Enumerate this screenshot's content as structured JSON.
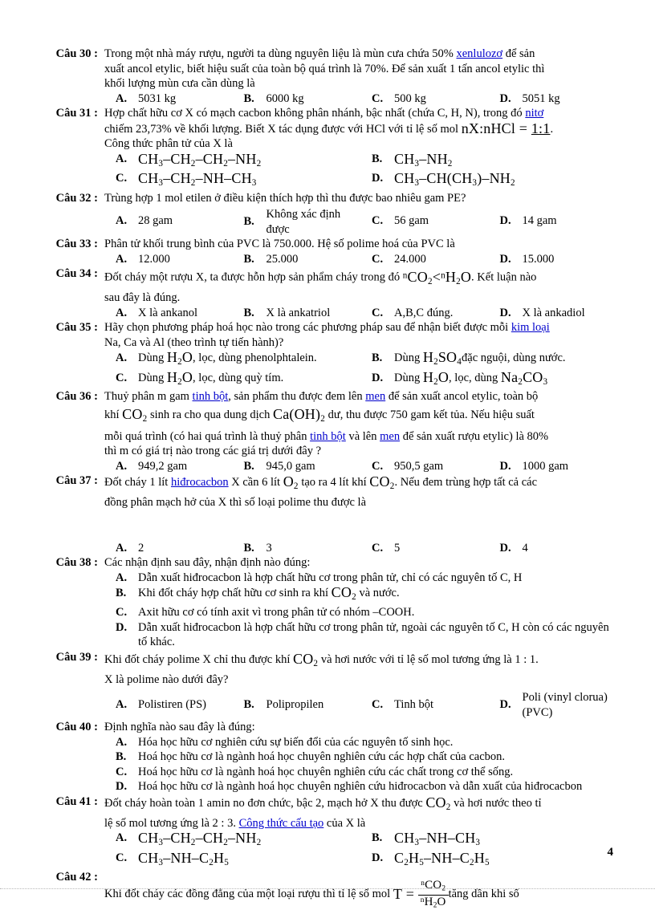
{
  "document": {
    "page_number": "4",
    "language": "vi"
  },
  "questions": [
    {
      "label": "Câu 30 :",
      "stem_lines": [
        "Trong một nhà máy rượu, người ta dùng nguyên liệu là mùn cưa chứa 50% xenlulozơ để sản",
        "xuất ancol etylic, biết hiệu suất của toàn bộ quá trình là 70%. Để sản xuất 1 tấn ancol etylic thì",
        "khối lượng mùn cưa cần dùng là"
      ],
      "link_terms": [
        "xenlulozơ"
      ],
      "answers": [
        {
          "key": "A.",
          "text": "5031 kg"
        },
        {
          "key": "B.",
          "text": "6000 kg"
        },
        {
          "key": "C.",
          "text": "500 kg"
        },
        {
          "key": "D.",
          "text": "5051 kg"
        }
      ]
    },
    {
      "label": "Câu 31 :",
      "stem_lines": [
        "Hợp chất hữu cơ X có mạch cacbon không phân nhánh, bậc nhất (chứa C, H, N), trong đó nitơ",
        "chiếm 23,73% về khối lượng. Biết X tác dụng được với HCl với tỉ lệ số mol nX:nHCl = 1:1.",
        "Công thức phân tử của X là"
      ],
      "link_terms": [
        "nitơ"
      ],
      "formula_inline": "nX:nHCl = 1:1",
      "answers": [
        {
          "key": "A.",
          "formula": "CH3–CH2–CH2–NH2"
        },
        {
          "key": "B.",
          "formula": "CH3–NH2"
        },
        {
          "key": "C.",
          "formula": "CH3–CH2–NH–CH3"
        },
        {
          "key": "D.",
          "formula": "CH3–CH(CH3)–NH2"
        }
      ]
    },
    {
      "label": "Câu 32 :",
      "stem_lines": [
        "Trùng hợp 1 mol etilen ở điều kiện thích hợp thì thu được bao nhiêu gam PE?"
      ],
      "answers": [
        {
          "key": "A.",
          "text": "28 gam"
        },
        {
          "key": "B.",
          "text": "Không xác định được"
        },
        {
          "key": "C.",
          "text": "56 gam"
        },
        {
          "key": "D.",
          "text": "14 gam"
        }
      ]
    },
    {
      "label": "Câu 33 :",
      "stem_lines": [
        "Phân tử khối trung bình của PVC là 750.000. Hệ số polime hoá của PVC là"
      ],
      "answers": [
        {
          "key": "A.",
          "text": "12.000"
        },
        {
          "key": "B.",
          "text": "25.000"
        },
        {
          "key": "C.",
          "text": "24.000"
        },
        {
          "key": "D.",
          "text": "15.000"
        }
      ]
    },
    {
      "label": "Câu 34 :",
      "stem_lines": [
        "Đốt cháy một rượu X, ta được hỗn hợp sản phẩm cháy trong đó nCO2 < nH2O. Kết luận nào",
        "sau đây là đúng."
      ],
      "formula_inline": "nCO2 < nH2O",
      "answers": [
        {
          "key": "A.",
          "text": "X là ankanol"
        },
        {
          "key": "B.",
          "text": "X là ankatriol"
        },
        {
          "key": "C.",
          "text": "A,B,C đúng."
        },
        {
          "key": "D.",
          "text": "X là ankadiol"
        }
      ]
    },
    {
      "label": "Câu 35 :",
      "stem_lines": [
        "Hãy chọn phương pháp hoá học nào trong các phương pháp sau để nhận biết được mỗi kim loại",
        "Na, Ca và Al (theo trình tự tiến hành)?"
      ],
      "link_terms": [
        "kim loại"
      ],
      "answers": [
        {
          "key": "A.",
          "text_pre": "Dùng ",
          "formula": "H2O",
          "text_post": ", lọc, dùng phenolphtalein."
        },
        {
          "key": "B.",
          "text_pre": "Dùng ",
          "formula": "H2SO4",
          "text_post": "đặc nguội, dùng nước."
        },
        {
          "key": "C.",
          "text_pre": "Dùng ",
          "formula": "H2O",
          "text_post": ", lọc, dùng quỳ tím."
        },
        {
          "key": "D.",
          "text_pre": "Dùng ",
          "formula": "H2O",
          "text_post": ", lọc, dùng ",
          "formula2": "Na2CO3"
        }
      ]
    },
    {
      "label": "Câu 36 :",
      "stem_lines": [
        "Thuỷ phân m gam tinh bột, sản phẩm thu được đem lên men để sản xuất ancol etylic, toàn bộ",
        "khí CO2 sinh ra cho qua dung dịch Ca(OH)2 dư, thu được 750 gam kết tủa. Nếu hiệu suất",
        "mỗi quá trình (có hai quá trình là thuỷ phân tinh bột và lên men để sản xuất rượu etylic) là 80%",
        "thì m có giá trị nào trong các giá trị dưới đây ?"
      ],
      "link_terms": [
        "tinh bột",
        "men"
      ],
      "answers": [
        {
          "key": "A.",
          "text": "949,2 gam"
        },
        {
          "key": "B.",
          "text": "945,0 gam"
        },
        {
          "key": "C.",
          "text": "950,5 gam"
        },
        {
          "key": "D.",
          "text": "1000 gam"
        }
      ]
    },
    {
      "label": "Câu 37 :",
      "stem_lines": [
        "Đốt cháy 1 lít hiđrocacbon X cần 6 lít O2 tạo ra 4 lít khí CO2. Nếu đem trùng hợp tất cả các",
        "đồng phân mạch hở của X thì số loại polime thu được là"
      ],
      "link_terms": [
        "hiđrocacbon"
      ],
      "answers": [
        {
          "key": "A.",
          "text": "2"
        },
        {
          "key": "B.",
          "text": "3"
        },
        {
          "key": "C.",
          "text": "5"
        },
        {
          "key": "D.",
          "text": "4"
        }
      ]
    },
    {
      "label": "Câu 38 :",
      "stem_lines": [
        "Các nhận định sau đây, nhận định nào đúng:"
      ],
      "answers_stacked": [
        {
          "key": "A.",
          "text": "Dẫn xuất hiđrocacbon là hợp chất hữu cơ trong phân tử, chỉ có các nguyên tố C, H"
        },
        {
          "key": "B.",
          "text_pre": "Khi đốt cháy hợp chất hữu cơ sinh ra khí ",
          "formula": "CO2",
          "text_post": " và nước."
        },
        {
          "key": "C.",
          "text": "Axit hữu cơ có tính axit vì trong phân tử có nhóm –COOH."
        },
        {
          "key": "D.",
          "text": "Dẫn xuất hiđrocacbon là hợp chất hữu cơ trong phân tử, ngoài các nguyên tố C, H còn có các nguyên tố khác."
        }
      ]
    },
    {
      "label": "Câu 39 :",
      "stem_lines": [
        "Khi đốt cháy polime X chỉ thu được khí CO2 và hơi nước với tỉ lệ số mol tương ứng là 1 : 1.",
        "X là polime nào dưới đây?"
      ],
      "answers": [
        {
          "key": "A.",
          "text": "Polistiren (PS)"
        },
        {
          "key": "B.",
          "text": "Polipropilen"
        },
        {
          "key": "C.",
          "text": "Tinh bột"
        },
        {
          "key": "D.",
          "text": "Poli (vinyl clorua) (PVC)"
        }
      ]
    },
    {
      "label": "Câu 40 :",
      "stem_lines": [
        "Định nghĩa nào sau đây là đúng:"
      ],
      "answers_stacked": [
        {
          "key": "A.",
          "text": "Hóa học hữu cơ nghiên cứu sự biến đổi của các nguyên tố sinh học."
        },
        {
          "key": "B.",
          "text": "Hoá học hữu cơ là ngành hoá học chuyên nghiên cứu các hợp chất của cacbon."
        },
        {
          "key": "C.",
          "text": "Hoá học hữu cơ là ngành hoá học chuyên nghiên cứu các chất trong cơ thể sống."
        },
        {
          "key": "D.",
          "text": "Hoá học hữu cơ là ngành hoá học chuyên nghiên cứu hiđrocacbon và dẫn xuất của hiđrocacbon"
        }
      ]
    },
    {
      "label": "Câu 41 :",
      "stem_lines": [
        "Đốt cháy hoàn toàn 1 amin no đơn chức, bậc 2, mạch hở X thu được CO2 và hơi nước theo tỉ",
        "lệ số mol tương ứng là 2 : 3. Công thức cấu tạo của X là"
      ],
      "link_terms": [
        "Công thức cấu tạo"
      ],
      "answers": [
        {
          "key": "A.",
          "formula": "CH3–CH2–CH2–NH2"
        },
        {
          "key": "B.",
          "formula": "CH3–NH–CH3"
        },
        {
          "key": "C.",
          "formula": "CH3–NH–C2H5"
        },
        {
          "key": "D.",
          "formula": "C2H5–NH–C2H5"
        }
      ]
    },
    {
      "label": "Câu 42 :",
      "stem_lines": [
        "Khi đốt cháy các đồng đẳng của một loại rượu thì tỉ lệ số mol T = nCO2/nH2O tăng dần khi số"
      ],
      "formula_inline": "T = nCO2 / nH2O"
    }
  ],
  "text": {
    "q30_line1_a": "Trong một nhà máy rượu, người ta dùng nguyên liệu là mùn cưa chứa 50% ",
    "q30_link": "xenlulozơ",
    "q30_line1_b": " để sản",
    "q30_line2": "xuất ancol etylic, biết hiệu suất của toàn bộ quá trình là 70%. Để sản xuất 1 tấn ancol etylic thì",
    "q30_line3": "khối lượng mùn cưa cần dùng là",
    "q31_line1_a": "Hợp chất hữu cơ X có mạch cacbon không phân nhánh, bậc nhất (chứa C, H, N), trong đó ",
    "q31_link": "nitơ",
    "q31_line2_a": "chiếm 23,73% về khối lượng. Biết X tác dụng được với HCl với tỉ lệ số mol ",
    "q31_line2_b": ".",
    "q31_line3": "Công thức phân tử của X là",
    "q32_stem": "Trùng hợp 1 mol etilen ở điều kiện thích hợp thì thu được bao nhiêu gam PE?",
    "q33_stem": "Phân tử khối trung bình của PVC là 750.000. Hệ số polime hoá của PVC là",
    "q34_line1_a": "Đốt cháy một rượu X, ta được hỗn hợp sản phẩm cháy trong đó ",
    "q34_line1_b": ". Kết luận nào",
    "q34_line2": "sau đây là đúng.",
    "q35_line1_a": "Hãy chọn phương pháp hoá học nào trong các phương pháp sau để nhận biết được mỗi ",
    "q35_link": "kim loại",
    "q35_line2": "Na, Ca và Al (theo trình tự tiến hành)?",
    "q36_line1_a": "Thuỷ phân m gam ",
    "q36_link1": "tinh bột",
    "q36_line1_b": ", sản phẩm thu được đem lên ",
    "q36_link2": "men",
    "q36_line1_c": " để sản xuất ancol etylic, toàn bộ",
    "q36_line2_a": "khí ",
    "q36_line2_b": " sinh ra cho qua dung dịch ",
    "q36_line2_c": " dư, thu được 750 gam kết tủa. Nếu hiệu suất",
    "q36_line3_a": "mỗi quá trình (có hai quá trình là thuỷ phân ",
    "q36_link3": "tinh bột",
    "q36_line3_b": " và lên ",
    "q36_link4": "men",
    "q36_line3_c": " để sản xuất rượu etylic) là 80%",
    "q36_line4": "thì m có giá trị nào trong các giá trị dưới đây ?",
    "q37_line1_a": "Đốt cháy 1 lít ",
    "q37_link": "hiđrocacbon",
    "q37_line1_b": " X cần 6 lít ",
    "q37_line1_c": " tạo ra 4 lít khí ",
    "q37_line1_d": ". Nếu đem trùng hợp tất cả các",
    "q37_line2": "đồng phân mạch hở của X thì số loại polime thu được là",
    "q38_stem": "Các nhận định sau đây, nhận định nào đúng:",
    "q39_line1_a": "Khi đốt cháy polime X chỉ thu được khí ",
    "q39_line1_b": " và hơi nước với tỉ lệ số mol tương ứng là 1 : 1.",
    "q39_line2": "X là polime nào dưới đây?",
    "q40_stem": "Định nghĩa nào sau đây là đúng:",
    "q41_line1_a": "Đốt cháy hoàn toàn 1 amin no đơn chức, bậc 2, mạch hở X thu được ",
    "q41_line1_b": " và hơi nước theo tỉ",
    "q41_line2_a": "lệ số mol tương ứng là 2 : 3. ",
    "q41_link": "Công thức cấu tạo",
    "q41_line2_b": " của X là",
    "q42_line_a": "Khi đốt cháy các đồng đẳng của một loại rượu thì tỉ lệ số mol ",
    "q42_line_b": "tăng dần khi số"
  }
}
